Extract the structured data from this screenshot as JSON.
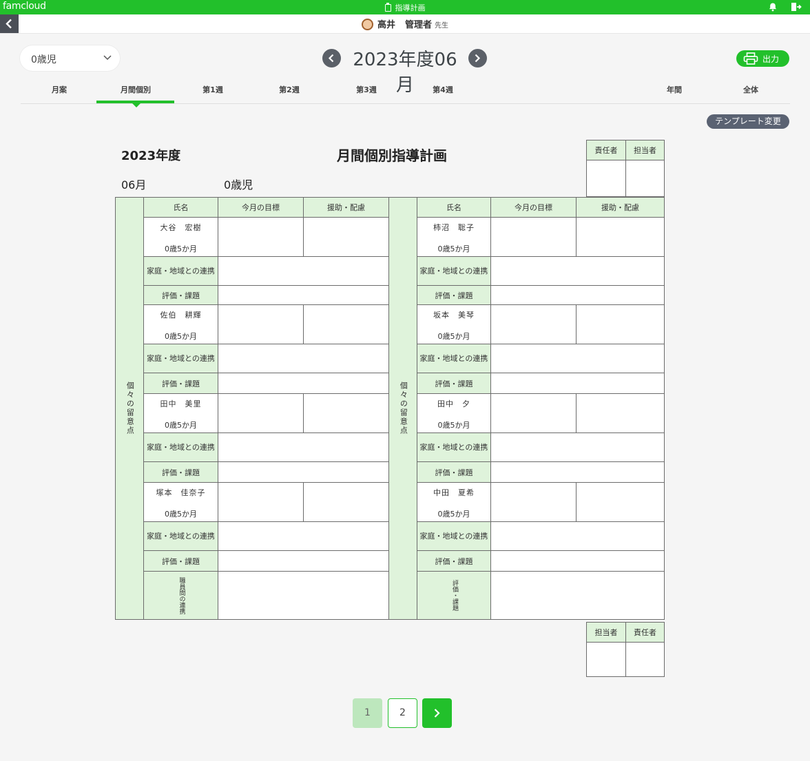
{
  "app": {
    "logo": "famcloud",
    "page_title": "指導計画"
  },
  "user": {
    "name": "高井",
    "role": "管理者",
    "suffix": "先生"
  },
  "class_select": {
    "value": "0歳児"
  },
  "period": {
    "label": "2023年度06月"
  },
  "print_label": "出力",
  "tabs": [
    {
      "label": "月案"
    },
    {
      "label": "月間個別"
    },
    {
      "label": "第1週"
    },
    {
      "label": "第2週"
    },
    {
      "label": "第3週"
    },
    {
      "label": "第4週"
    },
    {
      "label": "年間"
    },
    {
      "label": "全体"
    }
  ],
  "active_tab": "月間個別",
  "template_button": "テンプレート変更",
  "doc": {
    "year": "2023年度",
    "title": "月間個別指導計画",
    "month": "06月",
    "class_name": "0歳児",
    "top_stamps": [
      "責任者",
      "担当者"
    ],
    "bottom_stamps": [
      "担当者",
      "責任者"
    ],
    "headers": {
      "name": "氏名",
      "goal": "今月の目標",
      "support": "援助・配慮"
    },
    "side_label": "個々の留意点",
    "family_label": "家庭・地域との連携",
    "eval_label": "評価・課題",
    "staff_label": "職員間の連携",
    "bottom_eval_label": "評価・課題",
    "left_children": [
      {
        "name": "大谷　宏樹",
        "age": "0歳5か月"
      },
      {
        "name": "佐伯　耕輝",
        "age": "0歳5か月"
      },
      {
        "name": "田中　美里",
        "age": "0歳5か月"
      },
      {
        "name": "塚本　佳奈子",
        "age": "0歳5か月"
      }
    ],
    "right_children": [
      {
        "name": "柿沼　聡子",
        "age": "0歳5か月"
      },
      {
        "name": "坂本　美琴",
        "age": "0歳5か月"
      },
      {
        "name": "田中　夕",
        "age": "0歳5か月"
      },
      {
        "name": "中田　夏希",
        "age": "0歳5か月"
      }
    ]
  },
  "pagination": {
    "pages": [
      "1",
      "2"
    ],
    "current": "1"
  },
  "colors": {
    "brand": "#22c02b",
    "header_cell": "#dff3db",
    "nav_dark": "#5b6068"
  }
}
